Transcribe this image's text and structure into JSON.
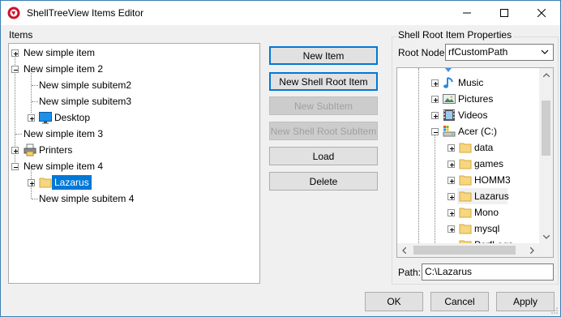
{
  "window": {
    "title": "ShellTreeView Items Editor"
  },
  "items_panel": {
    "label": "Items",
    "tree": [
      {
        "label": "New simple item"
      },
      {
        "label": "New simple item 2"
      },
      {
        "label": "New simple subitem2"
      },
      {
        "label": "New simple subitem3"
      },
      {
        "label": "Desktop"
      },
      {
        "label": "New simple item 3"
      },
      {
        "label": "Printers"
      },
      {
        "label": "New simple item 4"
      },
      {
        "label": "Lazarus",
        "selected": true
      },
      {
        "label": "New simple subitem 4"
      }
    ]
  },
  "buttons": {
    "new_item": "New Item",
    "new_shell_root_item": "New Shell Root Item",
    "new_subitem": "New SubItem",
    "new_shell_root_subitem": "New Shell Root SubItem",
    "load": "Load",
    "delete": "Delete"
  },
  "properties": {
    "group_label": "Shell Root Item Properties",
    "root_node_label": "Root Node:",
    "root_node_value": "rfCustomPath",
    "shell_tree": [
      {
        "label": "Music"
      },
      {
        "label": "Pictures"
      },
      {
        "label": "Videos"
      },
      {
        "label": "Acer (C:)"
      },
      {
        "label": "data"
      },
      {
        "label": "games"
      },
      {
        "label": "HOMM3"
      },
      {
        "label": "Lazarus"
      },
      {
        "label": "Mono"
      },
      {
        "label": "mysql"
      },
      {
        "label": "PerfLogs"
      }
    ],
    "path_label": "Path:",
    "path_value": "C:\\Lazarus"
  },
  "footer": {
    "ok": "OK",
    "cancel": "Cancel",
    "apply": "Apply"
  },
  "colors": {
    "selection": "#0078d7",
    "folder": "#f7d680",
    "accent_border": "#0078d7"
  }
}
